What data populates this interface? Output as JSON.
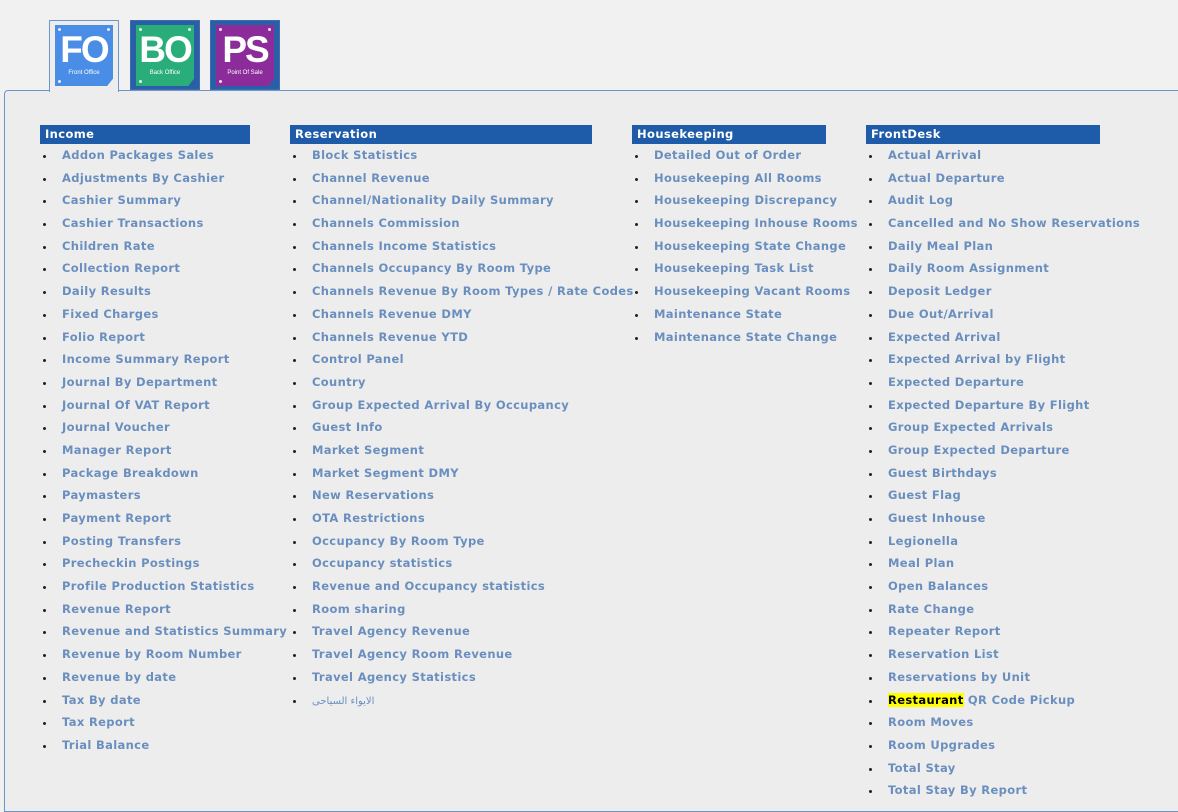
{
  "modules": [
    {
      "abbr": "FO",
      "label": "Front Office",
      "color": "#4a8de6",
      "active": true
    },
    {
      "abbr": "BO",
      "label": "Back Office",
      "color": "#2aae79",
      "active": false
    },
    {
      "abbr": "PS",
      "label": "Point Of Sale",
      "color": "#8b2c9a",
      "active": false
    }
  ],
  "columns": [
    {
      "title": "Income",
      "items": [
        "Addon Packages Sales",
        "Adjustments By Cashier",
        "Cashier Summary",
        "Cashier Transactions",
        "Children Rate",
        "Collection Report",
        "Daily Results",
        "Fixed Charges",
        "Folio Report",
        "Income Summary Report",
        "Journal By Department",
        "Journal Of VAT Report",
        "Journal Voucher",
        "Manager Report",
        "Package Breakdown",
        "Paymasters",
        "Payment Report",
        "Posting Transfers",
        "Precheckin Postings",
        "Profile Production Statistics",
        "Revenue Report",
        "Revenue and Statistics Summary",
        "Revenue by Room Number",
        "Revenue by date",
        "Tax By date",
        "Tax Report",
        "Trial Balance"
      ]
    },
    {
      "title": "Reservation",
      "items": [
        "Block Statistics",
        "Channel Revenue",
        "Channel/Nationality Daily Summary",
        "Channels Commission",
        "Channels Income Statistics",
        "Channels Occupancy By Room Type",
        "Channels Revenue By Room Types / Rate Codes",
        "Channels Revenue DMY",
        "Channels Revenue YTD",
        "Control Panel",
        "Country",
        "Group Expected Arrival By Occupancy",
        "Guest Info",
        "Market Segment",
        "Market Segment DMY",
        "New Reservations",
        "OTA Restrictions",
        "Occupancy By Room Type",
        "Occupancy statistics",
        "Revenue and Occupancy statistics",
        "Room sharing",
        "Travel Agency Revenue",
        "Travel Agency Room Revenue",
        "Travel Agency Statistics",
        "الايواء السياحى"
      ]
    },
    {
      "title": "Housekeeping",
      "items": [
        "Detailed Out of Order",
        "Housekeeping All Rooms",
        "Housekeeping Discrepancy",
        "Housekeeping Inhouse Rooms",
        "Housekeeping State Change",
        "Housekeeping Task List",
        "Housekeeping Vacant Rooms",
        "Maintenance State",
        "Maintenance State Change"
      ]
    },
    {
      "title": "FrontDesk",
      "items": [
        "Actual Arrival",
        "Actual Departure",
        "Audit Log",
        "Cancelled and No Show Reservations",
        "Daily Meal Plan",
        "Daily Room Assignment",
        "Deposit Ledger",
        "Due Out/Arrival",
        "Expected Arrival",
        "Expected Arrival by Flight",
        "Expected Departure",
        "Expected Departure By Flight",
        "Group Expected Arrivals",
        "Group Expected Departure",
        "Guest Birthdays",
        "Guest Flag",
        "Guest Inhouse",
        "Legionella",
        "Meal Plan",
        "Open Balances",
        "Rate Change",
        "Repeater Report",
        "Reservation List",
        "Reservations by Unit",
        "Restaurant QR Code Pickup",
        "Room Moves",
        "Room Upgrades",
        "Total Stay",
        "Total Stay By Report"
      ]
    }
  ],
  "highlight": {
    "text": "Restaurant",
    "color": "#ffff00"
  },
  "colors": {
    "header_bg": "#1e5ba8",
    "link": "#6a8fbf",
    "panel_border": "#6c95c9"
  }
}
